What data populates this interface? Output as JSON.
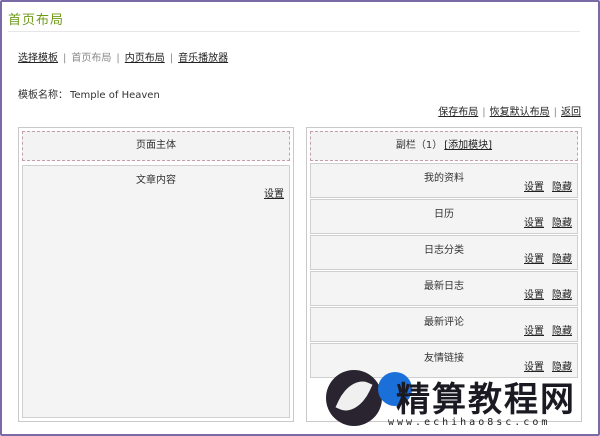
{
  "page": {
    "title": "首页布局"
  },
  "topnav": [
    {
      "label": "选择模板",
      "current": false
    },
    {
      "label": "首页布局",
      "current": true
    },
    {
      "label": "内页布局",
      "current": false
    },
    {
      "label": "音乐播放器",
      "current": false
    }
  ],
  "template": {
    "label": "模板名称：",
    "value": "Temple of Heaven"
  },
  "actions": {
    "save": "保存布局",
    "restore": "恢复默认布局",
    "back": "返回"
  },
  "main_column": {
    "header": "页面主体",
    "block": {
      "title": "文章内容",
      "settings": "设置"
    }
  },
  "side_column": {
    "header": "副栏（1）",
    "add_link": "[添加模块]",
    "blocks": [
      {
        "title": "我的资料",
        "settings": "设置",
        "hide": "隐藏"
      },
      {
        "title": "日历",
        "settings": "设置",
        "hide": "隐藏"
      },
      {
        "title": "日志分类",
        "settings": "设置",
        "hide": "隐藏"
      },
      {
        "title": "最新日志",
        "settings": "设置",
        "hide": "隐藏"
      },
      {
        "title": "最新评论",
        "settings": "设置",
        "hide": "隐藏"
      },
      {
        "title": "友情链接",
        "settings": "设置",
        "hide": "隐藏"
      }
    ]
  },
  "watermark": {
    "text": "精算教程网",
    "url": "www.echihao8sc.com"
  },
  "colors": {
    "title_green": "#6e9a16",
    "frame_purple": "#7a6aa8",
    "dashed_border": "#c4a0a6",
    "block_bg": "#f4f4f4"
  }
}
